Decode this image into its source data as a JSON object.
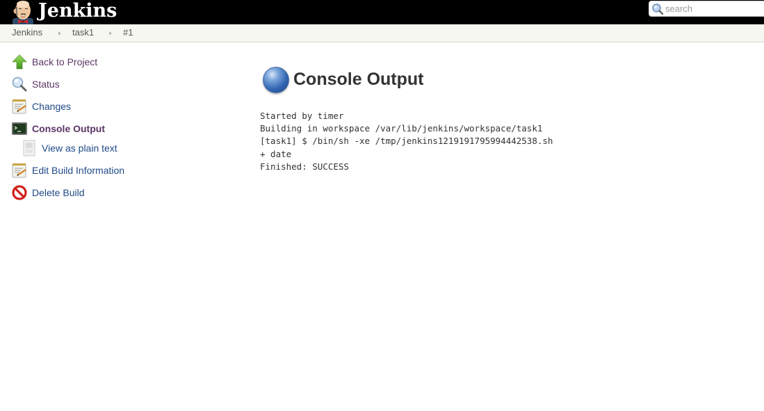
{
  "header": {
    "logo_text": "Jenkins",
    "search": {
      "placeholder": "search",
      "value": ""
    }
  },
  "breadcrumbs": [
    {
      "label": "Jenkins"
    },
    {
      "label": "task1"
    },
    {
      "label": "#1"
    }
  ],
  "sidebar": {
    "items": [
      {
        "label": "Back to Project",
        "icon": "up-arrow-icon",
        "state": "visited"
      },
      {
        "label": "Status",
        "icon": "magnifier-icon",
        "state": "visited"
      },
      {
        "label": "Changes",
        "icon": "notepad-icon",
        "state": "normal"
      },
      {
        "label": "Console Output",
        "icon": "terminal-icon",
        "state": "current"
      },
      {
        "label": "View as plain text",
        "icon": "document-icon",
        "state": "normal",
        "indent": true
      },
      {
        "label": "Edit Build Information",
        "icon": "notepad-icon",
        "state": "normal"
      },
      {
        "label": "Delete Build",
        "icon": "no-entry-icon",
        "state": "normal"
      }
    ]
  },
  "main": {
    "title": "Console Output",
    "status_icon": "blue-ball-icon",
    "console_lines": [
      "Started by timer",
      "Building in workspace /var/lib/jenkins/workspace/task1",
      "[task1] $ /bin/sh -xe /tmp/jenkins1219191795994442538.sh",
      "+ date",
      "Finished: SUCCESS"
    ]
  },
  "colors": {
    "header_bg": "#000000",
    "breadcrumb_bg": "#f6f7f1",
    "link": "#204a87",
    "visited_link": "#5c3566",
    "status_blue": "#3366b3"
  }
}
